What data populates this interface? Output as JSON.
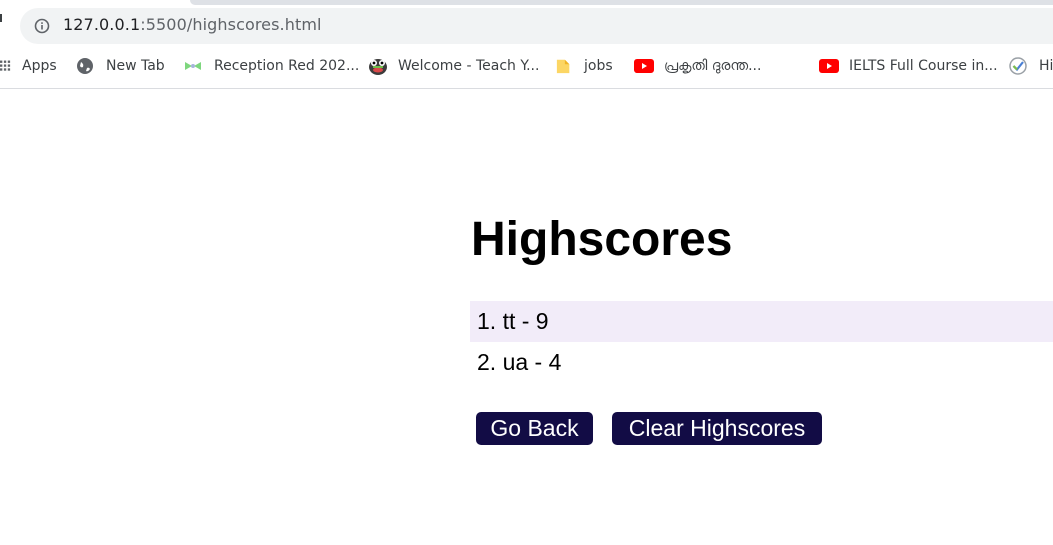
{
  "browser": {
    "url_host": "127.0.0.1",
    "url_rest": ":5500/highscores.html",
    "bookmarks": [
      {
        "label": "Apps",
        "icon": "apps-grid-icon"
      },
      {
        "label": "New Tab",
        "icon": "globe-icon"
      },
      {
        "label": "Reception Red 202...",
        "icon": "bow-icon"
      },
      {
        "label": "Welcome - Teach Y...",
        "icon": "frog-icon"
      },
      {
        "label": "jobs",
        "icon": "folder-icon"
      },
      {
        "label": "പ്രകൃതി ദുരന്ത...",
        "icon": "youtube-icon"
      },
      {
        "label": "IELTS Full Course in...",
        "icon": "youtube-icon"
      },
      {
        "label": "Hi",
        "icon": "check-icon"
      }
    ]
  },
  "page": {
    "title": "Highscores",
    "scores": [
      "1. tt - 9",
      "2. ua - 4"
    ],
    "go_back_label": "Go Back",
    "clear_label": "Clear Highscores"
  },
  "colors": {
    "button_bg": "#120c45",
    "row_highlight": "#f2ecf9",
    "youtube_red": "#ff0000"
  }
}
